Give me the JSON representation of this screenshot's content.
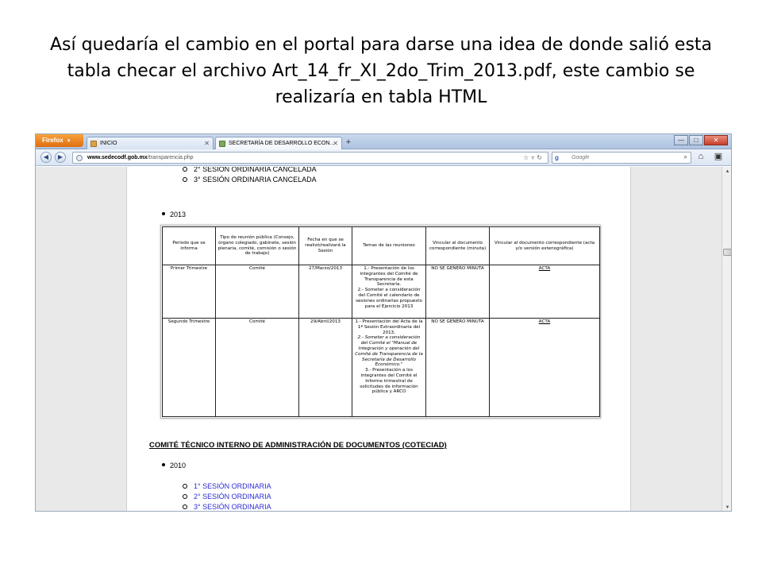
{
  "slide": {
    "title": "Así quedaría el cambio en el portal para darse una idea de donde salió esta tabla checar el archivo Art_14_fr_XI_2do_Trim_2013.pdf, este cambio se realizaría en tabla HTML"
  },
  "browser": {
    "app_button": "Firefox",
    "tabs": [
      {
        "label": "INICIO",
        "active": false
      },
      {
        "label": "SECRETARÍA DE DESARROLLO ECON...",
        "active": true
      }
    ],
    "new_tab": "+",
    "url_domain": "www.sedecodf.gob.mx",
    "url_path": "/transparencia.php",
    "search_placeholder": "Google",
    "window_buttons": [
      "—",
      "□",
      "✕"
    ]
  },
  "page": {
    "top_items": [
      "2° SESIÓN ORDINARIA CANCELADA",
      "3° SESIÓN ORDINARIA CANCELADA"
    ],
    "year_2013": "2013",
    "table": {
      "headers": [
        "Periodo que se informa",
        "Tipo de reunión pública (Consejo, órgano colegiado, gabinete, sesión plenaria, comité, comisión o sesión de trabajo)",
        "Fecha en que se realizó/realizará la Sesión",
        "Temas de las reuniones",
        "Vincular al documento correspondiente (minuta)",
        "Vincular al documento correspondiente (acta y/o versión estenográfica)"
      ],
      "rows": [
        {
          "periodo": "Primer Trimestre",
          "tipo": "Comité",
          "fecha": "27/Marzo/2013",
          "temas": [
            "1.- Presentación de los integrantes del Comité de Transparencia de esta Secretaría.",
            "2.- Someter a consideración del Comité el calendario de sesiones ordinarias propuesto para el Ejercicio 2013"
          ],
          "minuta": "NO SE GENERO MINUTA",
          "acta": "ACTA"
        },
        {
          "periodo": "Segundo Trimestre",
          "tipo": "Comité",
          "fecha": "29/Abril/2013",
          "temas": [
            "1.- Presentación del Acta de la 1ª Sesión Extraordinaria del 2013.",
            "2.- Someter a consideración del Comité el \"Manual de Integración y operación del Comité de Transparencia de la Secretaría de Desarrollo Económico.\"",
            "3.- Presentación a los integrantes del Comité el Informe trimestral de solicitudes de información pública y ARCO"
          ],
          "minuta": "NO SE GENERO MINUTA",
          "acta": "ACTA"
        }
      ]
    },
    "coteciad_heading": "COMITÉ TÉCNICO INTERNO DE ADMINISTRACIÓN DE DOCUMENTOS (COTECIAD)",
    "year_2010": "2010",
    "sessions_2010": [
      "1° SESIÓN ORDINARIA",
      "2° SESIÓN ORDINARIA",
      "3° SESIÓN ORDINARIA"
    ]
  }
}
